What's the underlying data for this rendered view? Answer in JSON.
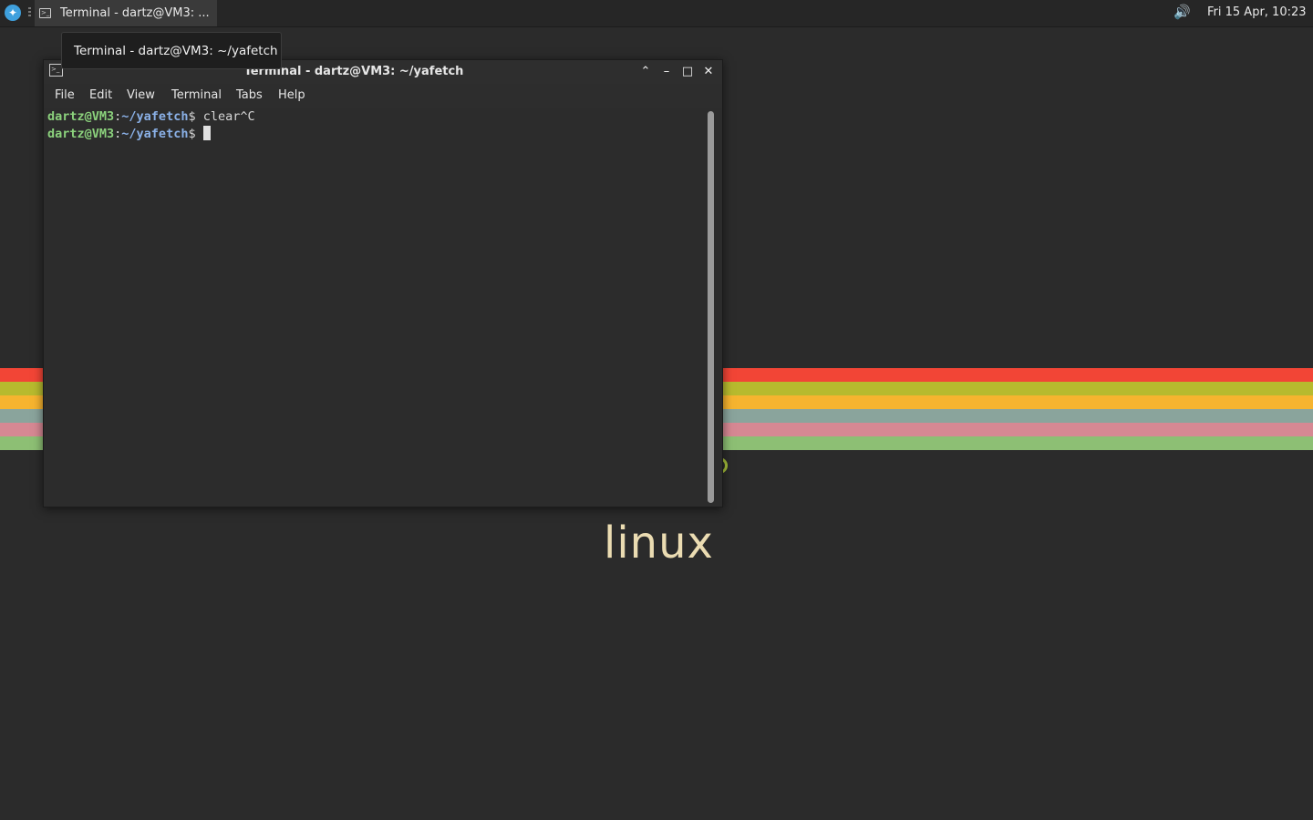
{
  "panel": {
    "taskbar_button": "Terminal - dartz@VM3: ...",
    "clock": "Fri 15 Apr, 10:23",
    "tooltip": "Terminal - dartz@VM3: ~/yafetch",
    "icons": [
      "whisker-menu-icon",
      "terminal-icon",
      "volume-icon"
    ]
  },
  "wallpaper": {
    "text": "linux",
    "stripe_colors": [
      "#f24536",
      "#b7ba2e",
      "#f6b42f",
      "#8aa49c",
      "#d68893",
      "#8dbf74"
    ]
  },
  "window": {
    "title": "Terminal - dartz@VM3: ~/yafetch",
    "menu": [
      "File",
      "Edit",
      "View",
      "Terminal",
      "Tabs",
      "Help"
    ],
    "lines": [
      {
        "user": "dartz@VM3",
        "sep": ":",
        "path": "~/yafetch",
        "prompt": "$ ",
        "cmd": "clear^C"
      },
      {
        "user": "dartz@VM3",
        "sep": ":",
        "path": "~/yafetch",
        "prompt": "$ ",
        "cmd": ""
      }
    ]
  }
}
